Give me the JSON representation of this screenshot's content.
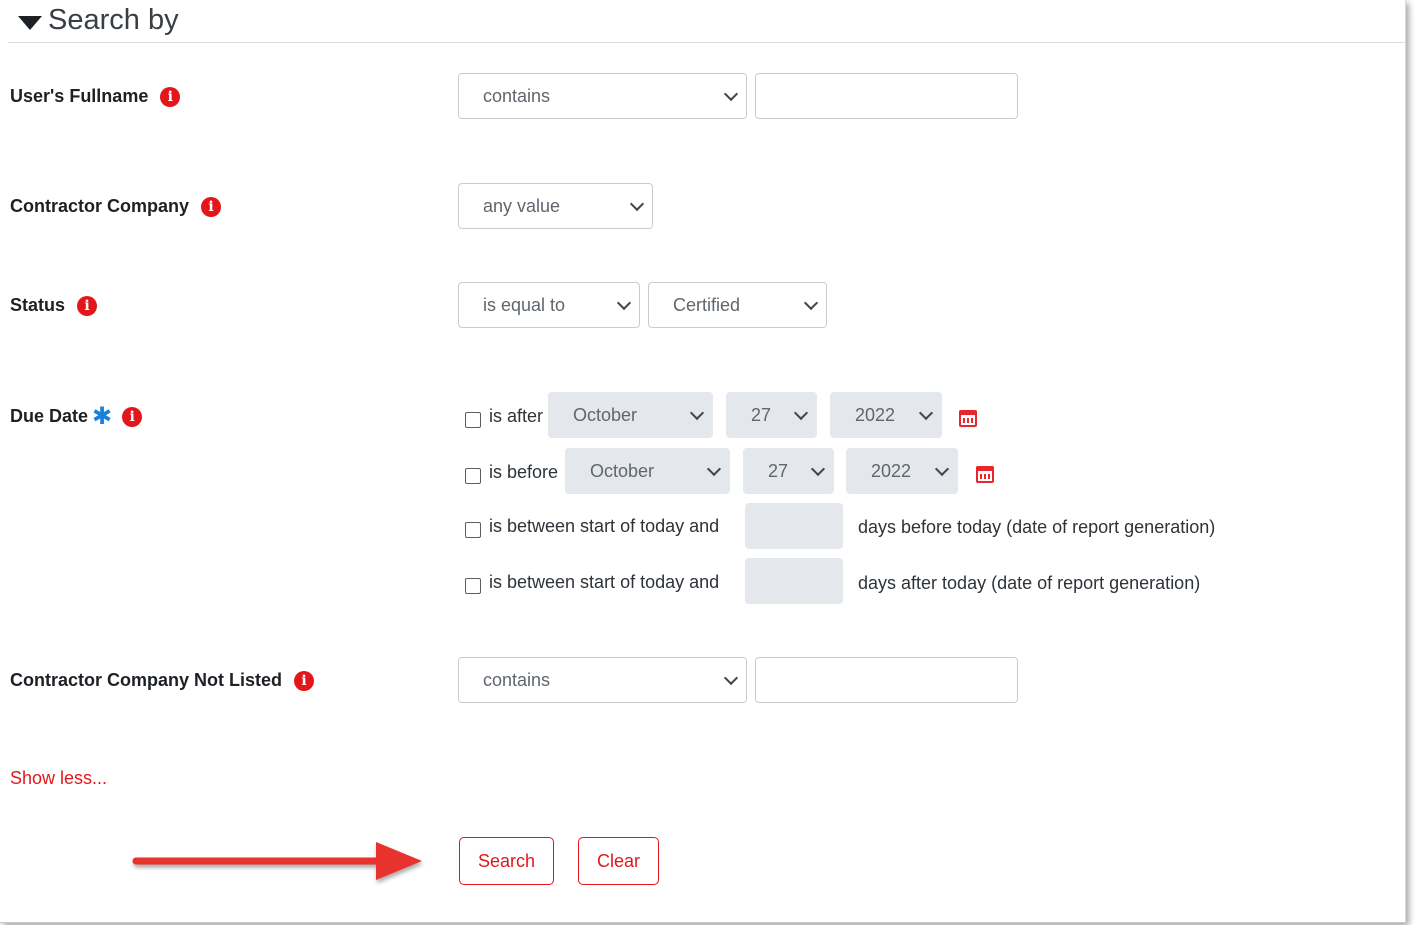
{
  "legend": {
    "title": "Search by"
  },
  "fields": {
    "fullname": {
      "label": "User's Fullname",
      "operator": "contains",
      "value": ""
    },
    "company": {
      "label": "Contractor Company",
      "operator": "any value"
    },
    "status": {
      "label": "Status",
      "operator": "is equal to",
      "value": "Certified"
    },
    "due_date": {
      "label": "Due Date",
      "after": {
        "label": "is after",
        "month": "October",
        "day": "27",
        "year": "2022"
      },
      "before": {
        "label": "is before",
        "month": "October",
        "day": "27",
        "year": "2022"
      },
      "between_before": {
        "label": "is between start of today and",
        "suffix": "days before today (date of report generation)"
      },
      "between_after": {
        "label": "is between start of today and",
        "suffix": "days after today (date of report generation)"
      }
    },
    "not_listed": {
      "label": "Contractor Company Not Listed",
      "operator": "contains",
      "value": ""
    }
  },
  "show_less": "Show less...",
  "buttons": {
    "search": "Search",
    "clear": "Clear"
  },
  "colors": {
    "accent": "#e3161c",
    "required": "#1a7fd6"
  },
  "icons": {
    "info": "info-icon",
    "calendar": "calendar-icon",
    "arrow": "arrow-right-icon"
  }
}
